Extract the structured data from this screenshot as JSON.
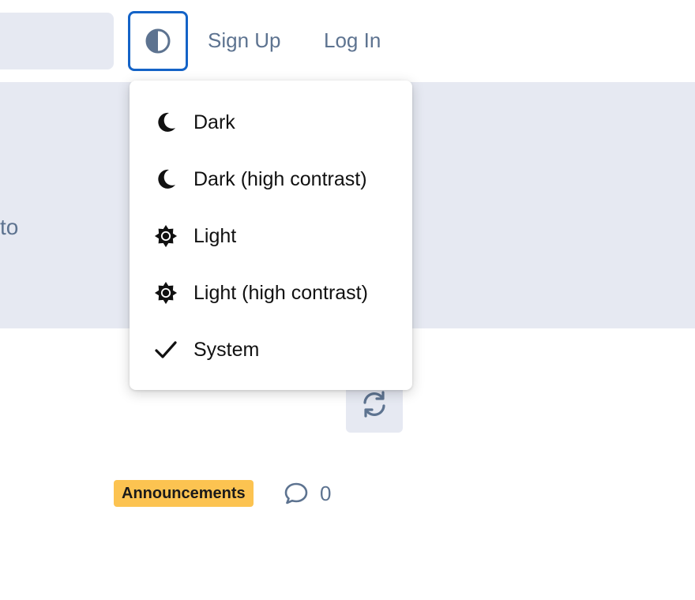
{
  "header": {
    "theme_toggle_icon": "half-circle-contrast-icon",
    "signup_label": "Sign Up",
    "login_label": "Log In"
  },
  "banner": {
    "text_fragment": "to"
  },
  "theme_menu": {
    "items": [
      {
        "label": "Dark",
        "icon": "moon-icon",
        "selected": false
      },
      {
        "label": "Dark (high contrast)",
        "icon": "moon-icon",
        "selected": false
      },
      {
        "label": "Light",
        "icon": "sun-icon",
        "selected": false
      },
      {
        "label": "Light (high contrast)",
        "icon": "sun-icon",
        "selected": false
      },
      {
        "label": "System",
        "icon": "checkmark-icon",
        "selected": true
      }
    ]
  },
  "refresh": {
    "icon": "refresh-icon"
  },
  "post_meta": {
    "category": "Announcements",
    "comment_icon": "comment-icon",
    "comment_count": "0"
  },
  "colors": {
    "accent_border": "#1463c7",
    "muted_text": "#5d7390",
    "panel_bg": "#e6e9f2",
    "badge_bg": "#fcc351"
  }
}
